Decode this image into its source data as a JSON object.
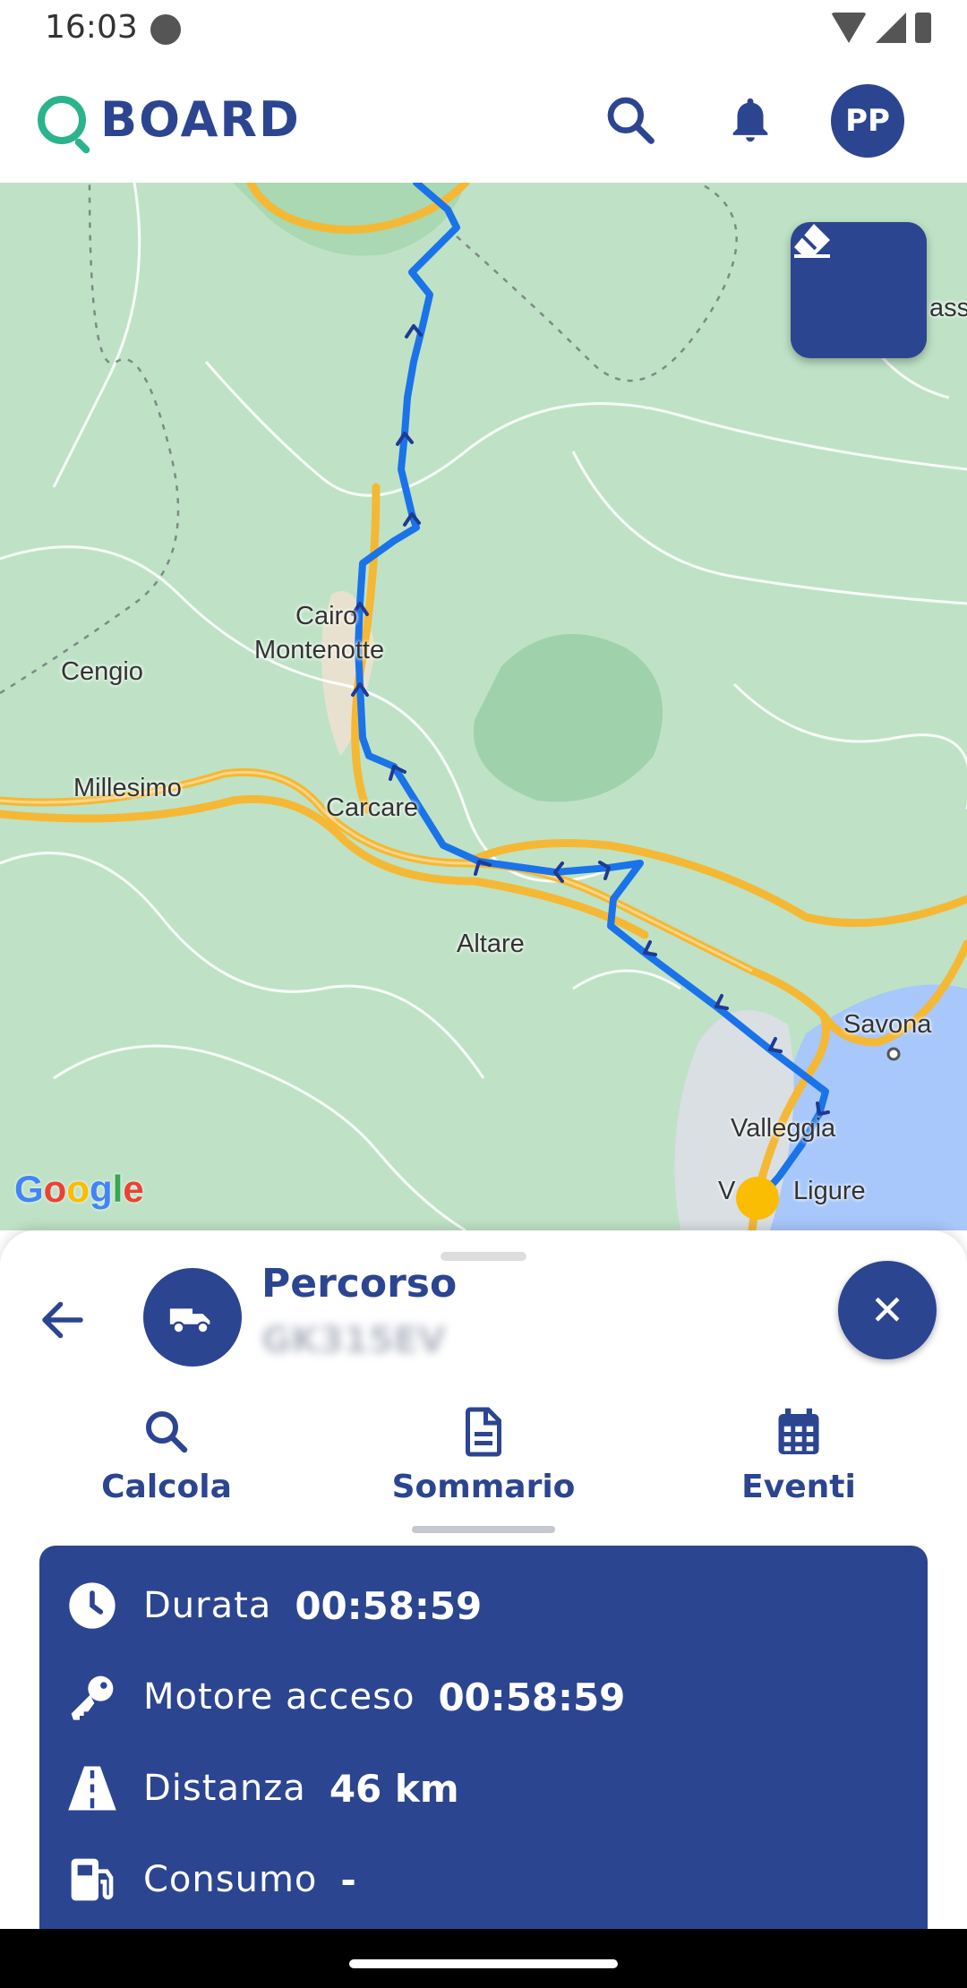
{
  "status_bar": {
    "time": "16:03"
  },
  "app_bar": {
    "logo_text": "BOARD",
    "avatar_initials": "PP"
  },
  "map": {
    "labels": {
      "cairo": "Cairo",
      "montenotte": "Montenotte",
      "cengio": "Cengio",
      "millesimo": "Millesimo",
      "carcare": "Carcare",
      "altare": "Altare",
      "savona": "Savona",
      "valleggia": "Valleggia",
      "vado_ligure": "V",
      "ligure": "Ligure",
      "edge": "ass"
    },
    "attribution": "Google"
  },
  "sheet": {
    "title": "Percorso",
    "plate": "GK315EV",
    "tabs": [
      {
        "label": "Calcola",
        "icon": "search-icon",
        "active": false
      },
      {
        "label": "Sommario",
        "icon": "document-icon",
        "active": true
      },
      {
        "label": "Eventi",
        "icon": "calendar-icon",
        "active": false
      }
    ],
    "summary": {
      "duration": {
        "label": "Durata",
        "value": "00:58:59",
        "icon": "clock-icon"
      },
      "engine_on": {
        "label": "Motore acceso",
        "value": "00:58:59",
        "icon": "key-icon"
      },
      "distance": {
        "label": "Distanza",
        "value": "46 km",
        "icon": "road-icon"
      },
      "consumption": {
        "label": "Consumo",
        "value": "-",
        "icon": "fuel-pump-icon"
      }
    }
  },
  "colors": {
    "brand": "#2c4591",
    "logo_q": "#2bb38d",
    "route": "#1a73e8",
    "roads": "#f5b835",
    "sea": "#a8c7fa",
    "end_marker": "#fbbc04"
  }
}
